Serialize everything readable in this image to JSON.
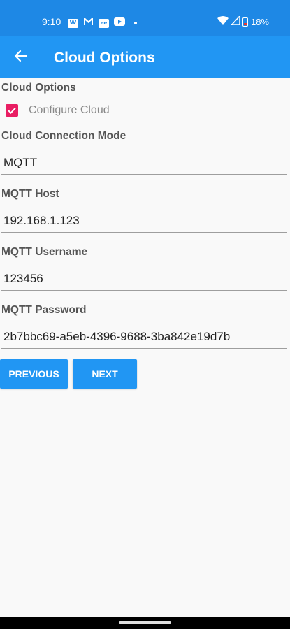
{
  "status_bar": {
    "time": "9:10",
    "battery": "18%",
    "icons": [
      "w-icon",
      "gmail-icon",
      "app-icon",
      "youtube-icon",
      "dot-icon",
      "wifi-icon",
      "signal-icon",
      "battery-icon"
    ]
  },
  "app_bar": {
    "title": "Cloud Options"
  },
  "form": {
    "section_title": "Cloud Options",
    "configure_cloud_label": "Configure Cloud",
    "configure_cloud_checked": true,
    "connection_mode_label": "Cloud Connection Mode",
    "connection_mode_value": "MQTT",
    "host_label": "MQTT Host",
    "host_value": "192.168.1.123",
    "username_label": "MQTT Username",
    "username_value": "123456",
    "password_label": "MQTT Password",
    "password_value": "2b7bbc69-a5eb-4396-9688-3ba842e19d7b"
  },
  "buttons": {
    "previous": "PREVIOUS",
    "next": "NEXT"
  },
  "colors": {
    "status_bar": "#1e88e5",
    "app_bar": "#2196f3",
    "checkbox": "#e91e63",
    "button": "#2196f3"
  }
}
